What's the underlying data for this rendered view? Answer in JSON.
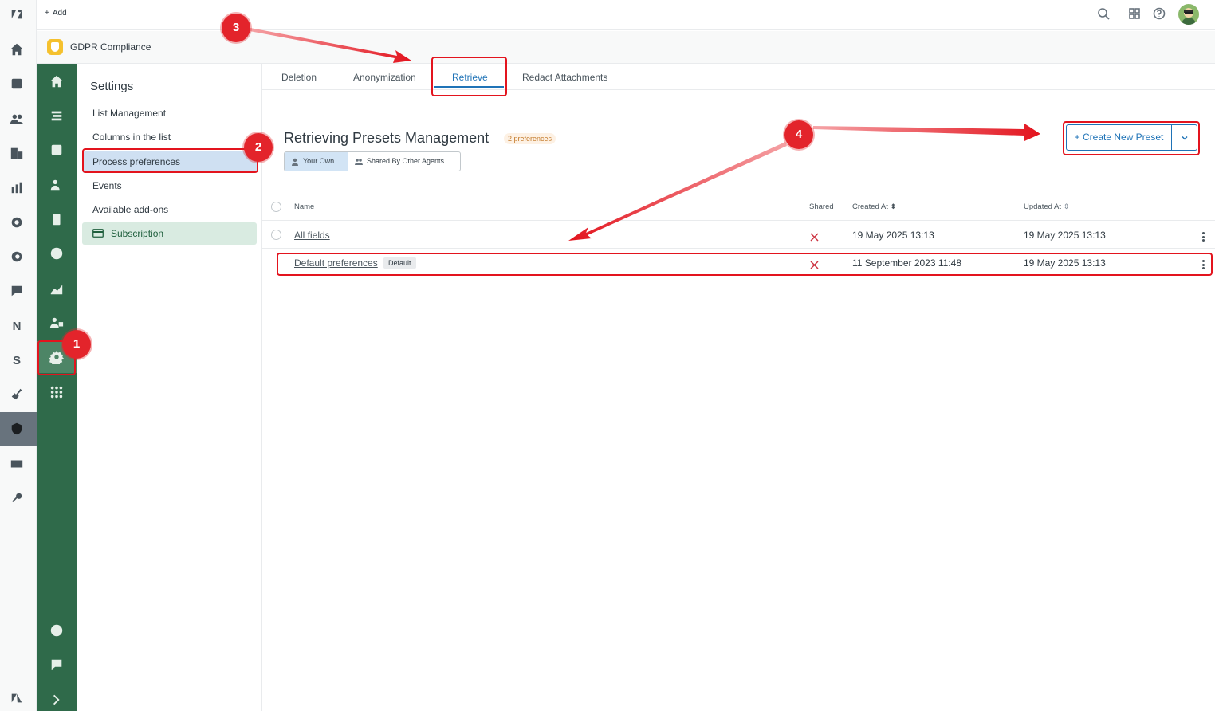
{
  "topbar": {
    "add_label": "Add"
  },
  "app": {
    "title": "GDPR Compliance"
  },
  "settings": {
    "title": "Settings",
    "items": [
      {
        "label": "List Management"
      },
      {
        "label": "Columns in the list"
      },
      {
        "label": "Process preferences"
      },
      {
        "label": "Events"
      },
      {
        "label": "Available add-ons"
      },
      {
        "label": "Subscription"
      }
    ]
  },
  "tabs": [
    {
      "label": "Deletion"
    },
    {
      "label": "Anonymization"
    },
    {
      "label": "Retrieve"
    },
    {
      "label": "Redact Attachments"
    }
  ],
  "main": {
    "title": "Retrieving Presets Management",
    "count_badge": "2 preferences",
    "filter_own": "Your Own",
    "filter_shared": "Shared By Other Agents",
    "create_label": "+ Create New Preset"
  },
  "table": {
    "headers": {
      "name": "Name",
      "shared": "Shared",
      "created": "Created At",
      "updated": "Updated At"
    },
    "rows": [
      {
        "name": "All fields",
        "created": "19 May 2025 13:13",
        "updated": "19 May 2025 13:13"
      },
      {
        "name": "Default preferences",
        "badge": "Default",
        "created": "11 September 2023 11:48",
        "updated": "19 May 2025 13:13"
      }
    ]
  },
  "annotations": [
    "1",
    "2",
    "3",
    "4"
  ],
  "colors": {
    "accent": "#1f73b7",
    "nav_green": "#2f6a4a",
    "annotation_red": "#e3141e"
  }
}
